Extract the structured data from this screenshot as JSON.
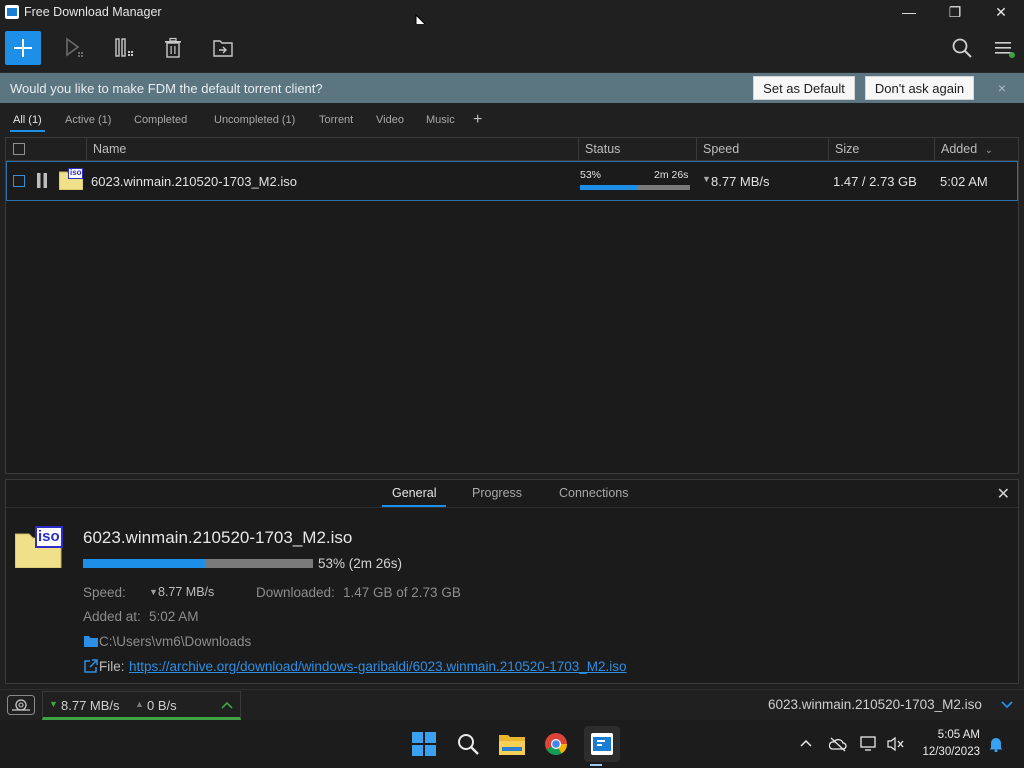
{
  "window": {
    "title": "Free Download Manager",
    "controls": {
      "minimize": "—",
      "restore": "❐",
      "close": "✕"
    }
  },
  "toolbar": {
    "add_icon": "plus-icon",
    "start_icon": "play-icon",
    "pause_icon": "pause-columns-icon",
    "delete_icon": "trash-icon",
    "move_icon": "folder-arrow-icon",
    "search_icon": "search-icon",
    "menu_icon": "menu-icon"
  },
  "banner": {
    "text": "Would you like to make FDM the default torrent client?",
    "set_default": "Set as Default",
    "dont_ask": "Don't ask again",
    "close": "×"
  },
  "filters": {
    "tabs": [
      "All (1)",
      "Active (1)",
      "Completed",
      "Uncompleted (1)",
      "Torrent",
      "Video",
      "Music"
    ],
    "add": "+"
  },
  "table": {
    "columns": {
      "name": "Name",
      "status": "Status",
      "speed": "Speed",
      "size": "Size",
      "added": "Added"
    },
    "sort_indicator": "⌄",
    "rows": [
      {
        "name": "6023.winmain.210520-1703_M2.iso",
        "file_icon_label": "iso",
        "percent": "53%",
        "progress": 0.53,
        "remaining": "2m 26s",
        "speed": "8.77 MB/s",
        "size": "1.47 / 2.73 GB",
        "added": "5:02 AM"
      }
    ]
  },
  "details": {
    "tabs": [
      "General",
      "Progress",
      "Connections"
    ],
    "close": "✕",
    "file_icon_label": "iso",
    "filename": "6023.winmain.210520-1703_M2.iso",
    "progress": 0.53,
    "progress_text": "53% (2m 26s)",
    "speed_label": "Speed:",
    "speed_value": "8.77 MB/s",
    "downloaded_label": "Downloaded:",
    "downloaded_value": "1.47 GB of 2.73 GB",
    "added_label": "Added at:",
    "added_value": "5:02 AM",
    "folder": "C:\\Users\\vm6\\Downloads",
    "file_label": "File:",
    "url": "https://archive.org/download/windows-garibaldi/6023.winmain.210520-1703_M2.iso"
  },
  "statusbar": {
    "download_speed": "8.77 MB/s",
    "upload_speed": "0 B/s",
    "current_file": "6023.winmain.210520-1703_M2.iso"
  },
  "taskbar": {
    "apps": [
      "start-icon",
      "search-icon",
      "file-explorer-icon",
      "chrome-icon",
      "fdm-icon"
    ],
    "time": "5:05 AM",
    "date": "12/30/2023"
  },
  "colors": {
    "accent": "#1e8fe6",
    "banner": "#5b7581",
    "success": "#3fa243"
  }
}
